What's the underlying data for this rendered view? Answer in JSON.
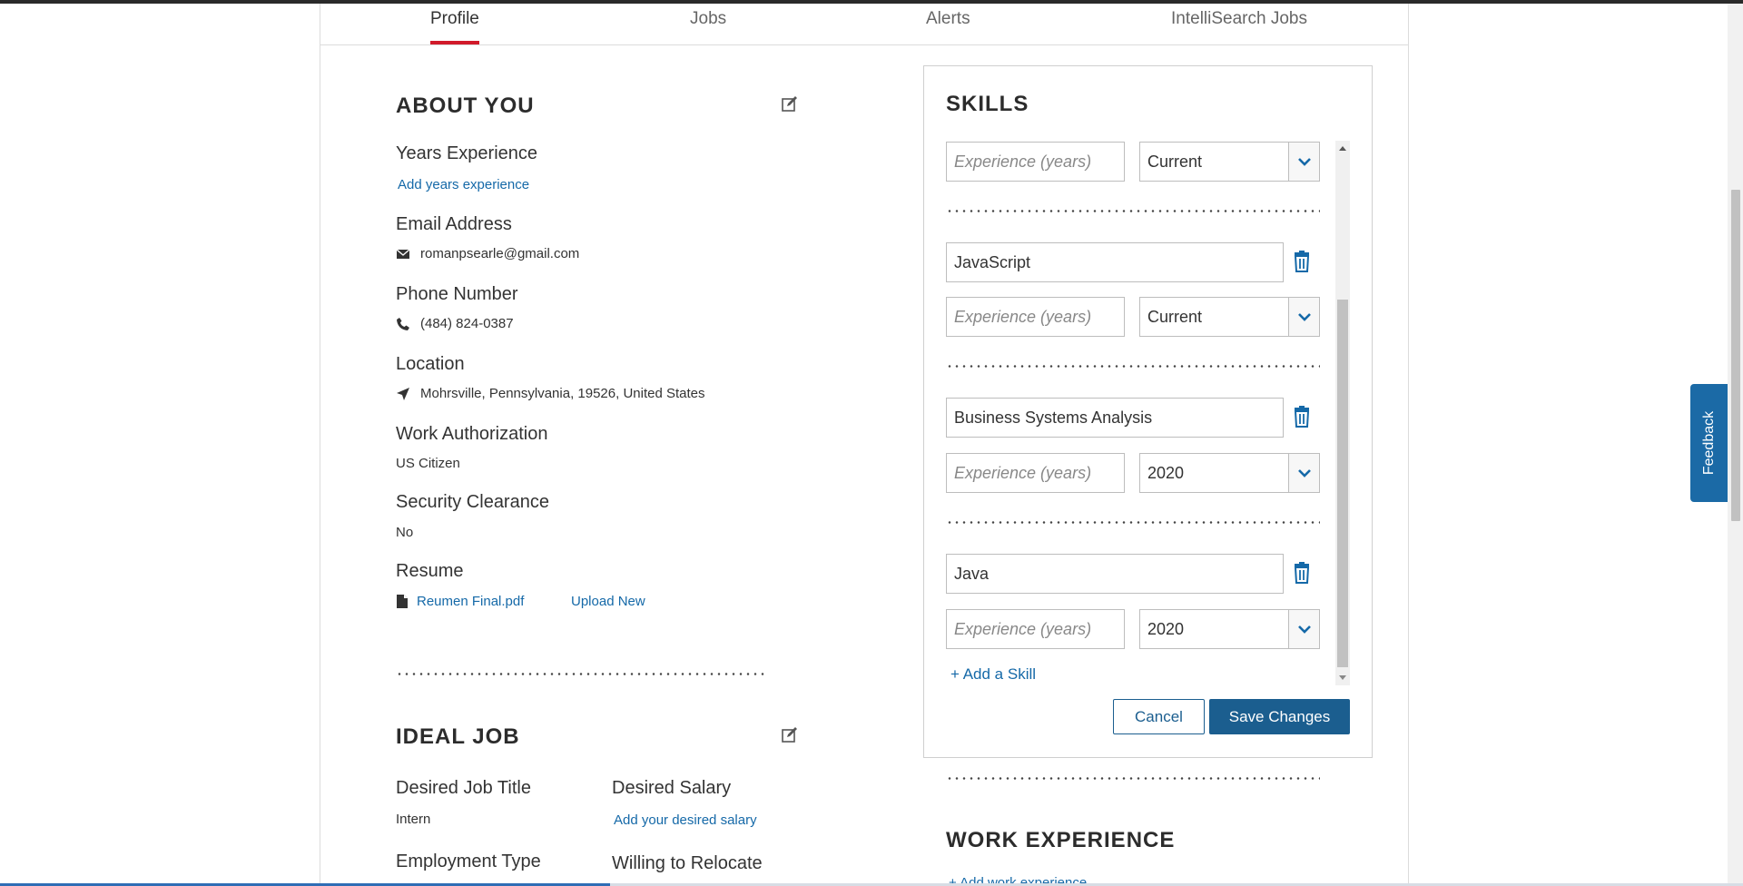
{
  "tabs": [
    {
      "label": "Profile",
      "active": true
    },
    {
      "label": "Jobs",
      "active": false
    },
    {
      "label": "Alerts",
      "active": false
    },
    {
      "label": "IntelliSearch Jobs",
      "active": false
    }
  ],
  "about": {
    "title": "ABOUT YOU",
    "years_label": "Years Experience",
    "years_link": "Add years experience",
    "email_label": "Email Address",
    "email": "romanpsearle@gmail.com",
    "phone_label": "Phone Number",
    "phone": "(484) 824-0387",
    "location_label": "Location",
    "location": "Mohrsville, Pennsylvania, 19526, United States",
    "auth_label": "Work Authorization",
    "auth": "US Citizen",
    "clearance_label": "Security Clearance",
    "clearance": "No",
    "resume_label": "Resume",
    "resume_file": "Reumen Final.pdf",
    "upload_link": "Upload New"
  },
  "ideal_job": {
    "title": "IDEAL JOB",
    "job_title_label": "Desired Job Title",
    "job_title": "Intern",
    "salary_label": "Desired Salary",
    "salary_link": "Add your desired salary",
    "employment_label": "Employment Type",
    "relocate_label": "Willing to Relocate"
  },
  "skills": {
    "title": "SKILLS",
    "experience_placeholder": "Experience (years)",
    "items": [
      {
        "name": "",
        "last_used": "Current"
      },
      {
        "name": "JavaScript",
        "last_used": "Current"
      },
      {
        "name": "Business Systems Analysis",
        "last_used": "2020"
      },
      {
        "name": "Java",
        "last_used": "2020"
      }
    ],
    "add_label": "+  Add a Skill",
    "cancel_label": "Cancel",
    "save_label": "Save Changes"
  },
  "work": {
    "title": "WORK EXPERIENCE",
    "add_link": "+ Add work experience"
  },
  "feedback_label": "Feedback",
  "colors": {
    "link": "#1569a8",
    "primary_button": "#1b5e8f",
    "active_tab_underline": "#d11a2a",
    "feedback_tab": "#1b6aa6"
  }
}
